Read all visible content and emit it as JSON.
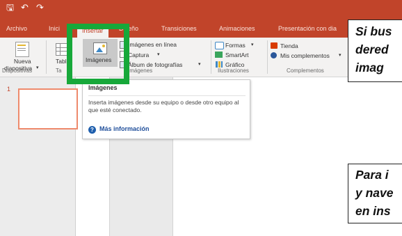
{
  "ribbon_tabs": [
    "Archivo",
    "Inici",
    "Insertar",
    "Diseño",
    "Transiciones",
    "Animaciones",
    "Presentación con dia"
  ],
  "ribbon": {
    "nueva_line1": "Nueva",
    "nueva_line2": "diapositiva",
    "tabla": "Tabla",
    "imagenes": "Imágenes",
    "imagenes_en_linea": "Imágenes en línea",
    "captura": "Captura",
    "album": "Álbum de fotografías",
    "formas": "Formas",
    "smartart": "SmartArt",
    "grafico": "Gráfico",
    "tienda": "Tienda",
    "mis_complementos": "Mis complementos",
    "groups": {
      "diapositivas": "Diapositivas",
      "tablas": "Ta",
      "imagenes": "Imágenes",
      "ilustraciones": "Ilustraciones",
      "complementos": "Complementos"
    }
  },
  "slides": {
    "number": "1"
  },
  "tooltip": {
    "title": "Imágenes",
    "desc": "Inserta imágenes desde su equipo o desde otro equipo al que esté conectado.",
    "more": "Más información"
  },
  "callouts": {
    "top": [
      "Si bus",
      "dered",
      "imag"
    ],
    "bottom": [
      "Para i",
      "y nave",
      "en ins"
    ]
  },
  "colors": {
    "accent": "#c1442a",
    "highlight": "#17a83a"
  }
}
